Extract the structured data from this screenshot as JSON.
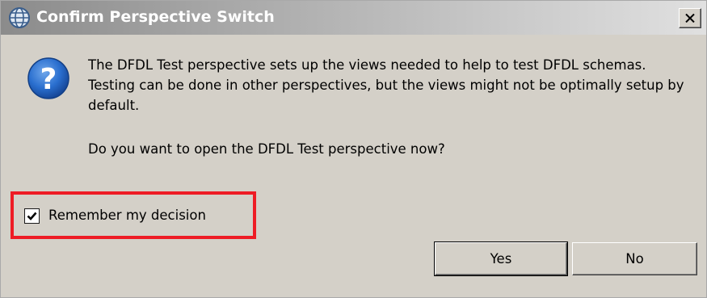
{
  "dialog": {
    "title": "Confirm Perspective Switch",
    "message": "The DFDL Test perspective sets up the views needed to help to test DFDL schemas. Testing can be done in other perspectives, but the views might not be optimally setup by default.",
    "question": "Do you want to open the DFDL Test perspective now?",
    "remember_label": "Remember my decision",
    "remember_checked": true,
    "buttons": {
      "yes": "Yes",
      "no": "No"
    }
  },
  "icons": {
    "title": "globe-icon",
    "close": "close-icon",
    "question": "question-icon",
    "checkmark": "checkmark-icon"
  },
  "colors": {
    "highlight_border": "#ee1c25",
    "dialog_bg": "#d4d0c8",
    "question_icon_blue": "#1c5dbf"
  }
}
